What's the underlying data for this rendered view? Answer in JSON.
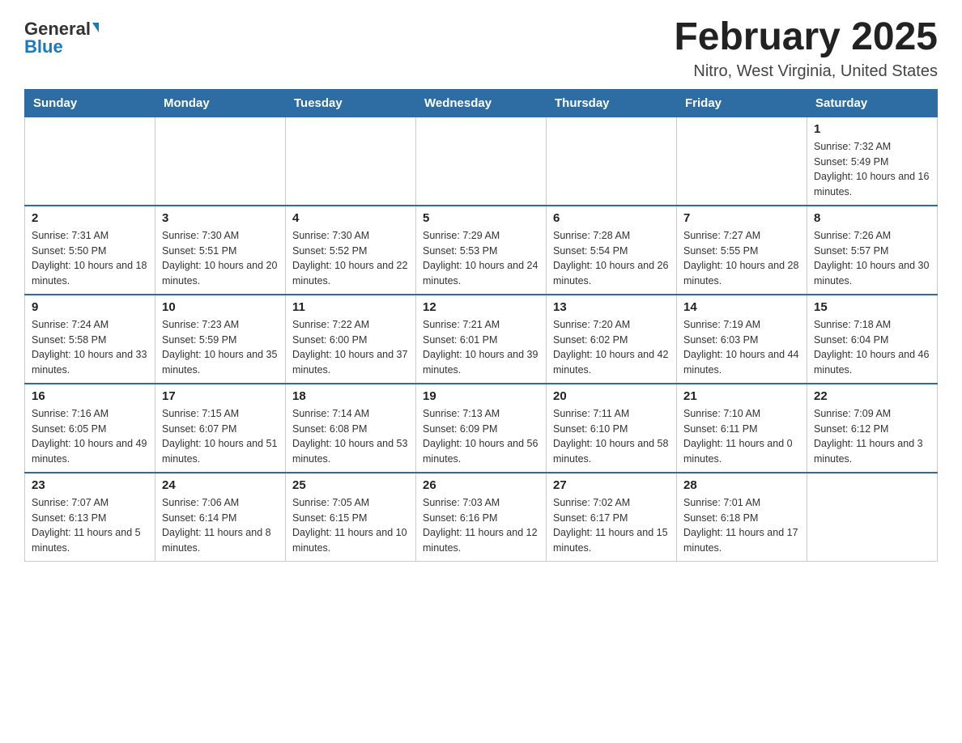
{
  "header": {
    "logo": {
      "general": "General",
      "blue": "Blue",
      "tagline": ""
    },
    "title": "February 2025",
    "subtitle": "Nitro, West Virginia, United States"
  },
  "weekdays": [
    "Sunday",
    "Monday",
    "Tuesday",
    "Wednesday",
    "Thursday",
    "Friday",
    "Saturday"
  ],
  "weeks": [
    [
      {
        "day": "",
        "sunrise": "",
        "sunset": "",
        "daylight": ""
      },
      {
        "day": "",
        "sunrise": "",
        "sunset": "",
        "daylight": ""
      },
      {
        "day": "",
        "sunrise": "",
        "sunset": "",
        "daylight": ""
      },
      {
        "day": "",
        "sunrise": "",
        "sunset": "",
        "daylight": ""
      },
      {
        "day": "",
        "sunrise": "",
        "sunset": "",
        "daylight": ""
      },
      {
        "day": "",
        "sunrise": "",
        "sunset": "",
        "daylight": ""
      },
      {
        "day": "1",
        "sunrise": "Sunrise: 7:32 AM",
        "sunset": "Sunset: 5:49 PM",
        "daylight": "Daylight: 10 hours and 16 minutes."
      }
    ],
    [
      {
        "day": "2",
        "sunrise": "Sunrise: 7:31 AM",
        "sunset": "Sunset: 5:50 PM",
        "daylight": "Daylight: 10 hours and 18 minutes."
      },
      {
        "day": "3",
        "sunrise": "Sunrise: 7:30 AM",
        "sunset": "Sunset: 5:51 PM",
        "daylight": "Daylight: 10 hours and 20 minutes."
      },
      {
        "day": "4",
        "sunrise": "Sunrise: 7:30 AM",
        "sunset": "Sunset: 5:52 PM",
        "daylight": "Daylight: 10 hours and 22 minutes."
      },
      {
        "day": "5",
        "sunrise": "Sunrise: 7:29 AM",
        "sunset": "Sunset: 5:53 PM",
        "daylight": "Daylight: 10 hours and 24 minutes."
      },
      {
        "day": "6",
        "sunrise": "Sunrise: 7:28 AM",
        "sunset": "Sunset: 5:54 PM",
        "daylight": "Daylight: 10 hours and 26 minutes."
      },
      {
        "day": "7",
        "sunrise": "Sunrise: 7:27 AM",
        "sunset": "Sunset: 5:55 PM",
        "daylight": "Daylight: 10 hours and 28 minutes."
      },
      {
        "day": "8",
        "sunrise": "Sunrise: 7:26 AM",
        "sunset": "Sunset: 5:57 PM",
        "daylight": "Daylight: 10 hours and 30 minutes."
      }
    ],
    [
      {
        "day": "9",
        "sunrise": "Sunrise: 7:24 AM",
        "sunset": "Sunset: 5:58 PM",
        "daylight": "Daylight: 10 hours and 33 minutes."
      },
      {
        "day": "10",
        "sunrise": "Sunrise: 7:23 AM",
        "sunset": "Sunset: 5:59 PM",
        "daylight": "Daylight: 10 hours and 35 minutes."
      },
      {
        "day": "11",
        "sunrise": "Sunrise: 7:22 AM",
        "sunset": "Sunset: 6:00 PM",
        "daylight": "Daylight: 10 hours and 37 minutes."
      },
      {
        "day": "12",
        "sunrise": "Sunrise: 7:21 AM",
        "sunset": "Sunset: 6:01 PM",
        "daylight": "Daylight: 10 hours and 39 minutes."
      },
      {
        "day": "13",
        "sunrise": "Sunrise: 7:20 AM",
        "sunset": "Sunset: 6:02 PM",
        "daylight": "Daylight: 10 hours and 42 minutes."
      },
      {
        "day": "14",
        "sunrise": "Sunrise: 7:19 AM",
        "sunset": "Sunset: 6:03 PM",
        "daylight": "Daylight: 10 hours and 44 minutes."
      },
      {
        "day": "15",
        "sunrise": "Sunrise: 7:18 AM",
        "sunset": "Sunset: 6:04 PM",
        "daylight": "Daylight: 10 hours and 46 minutes."
      }
    ],
    [
      {
        "day": "16",
        "sunrise": "Sunrise: 7:16 AM",
        "sunset": "Sunset: 6:05 PM",
        "daylight": "Daylight: 10 hours and 49 minutes."
      },
      {
        "day": "17",
        "sunrise": "Sunrise: 7:15 AM",
        "sunset": "Sunset: 6:07 PM",
        "daylight": "Daylight: 10 hours and 51 minutes."
      },
      {
        "day": "18",
        "sunrise": "Sunrise: 7:14 AM",
        "sunset": "Sunset: 6:08 PM",
        "daylight": "Daylight: 10 hours and 53 minutes."
      },
      {
        "day": "19",
        "sunrise": "Sunrise: 7:13 AM",
        "sunset": "Sunset: 6:09 PM",
        "daylight": "Daylight: 10 hours and 56 minutes."
      },
      {
        "day": "20",
        "sunrise": "Sunrise: 7:11 AM",
        "sunset": "Sunset: 6:10 PM",
        "daylight": "Daylight: 10 hours and 58 minutes."
      },
      {
        "day": "21",
        "sunrise": "Sunrise: 7:10 AM",
        "sunset": "Sunset: 6:11 PM",
        "daylight": "Daylight: 11 hours and 0 minutes."
      },
      {
        "day": "22",
        "sunrise": "Sunrise: 7:09 AM",
        "sunset": "Sunset: 6:12 PM",
        "daylight": "Daylight: 11 hours and 3 minutes."
      }
    ],
    [
      {
        "day": "23",
        "sunrise": "Sunrise: 7:07 AM",
        "sunset": "Sunset: 6:13 PM",
        "daylight": "Daylight: 11 hours and 5 minutes."
      },
      {
        "day": "24",
        "sunrise": "Sunrise: 7:06 AM",
        "sunset": "Sunset: 6:14 PM",
        "daylight": "Daylight: 11 hours and 8 minutes."
      },
      {
        "day": "25",
        "sunrise": "Sunrise: 7:05 AM",
        "sunset": "Sunset: 6:15 PM",
        "daylight": "Daylight: 11 hours and 10 minutes."
      },
      {
        "day": "26",
        "sunrise": "Sunrise: 7:03 AM",
        "sunset": "Sunset: 6:16 PM",
        "daylight": "Daylight: 11 hours and 12 minutes."
      },
      {
        "day": "27",
        "sunrise": "Sunrise: 7:02 AM",
        "sunset": "Sunset: 6:17 PM",
        "daylight": "Daylight: 11 hours and 15 minutes."
      },
      {
        "day": "28",
        "sunrise": "Sunrise: 7:01 AM",
        "sunset": "Sunset: 6:18 PM",
        "daylight": "Daylight: 11 hours and 17 minutes."
      },
      {
        "day": "",
        "sunrise": "",
        "sunset": "",
        "daylight": ""
      }
    ]
  ]
}
